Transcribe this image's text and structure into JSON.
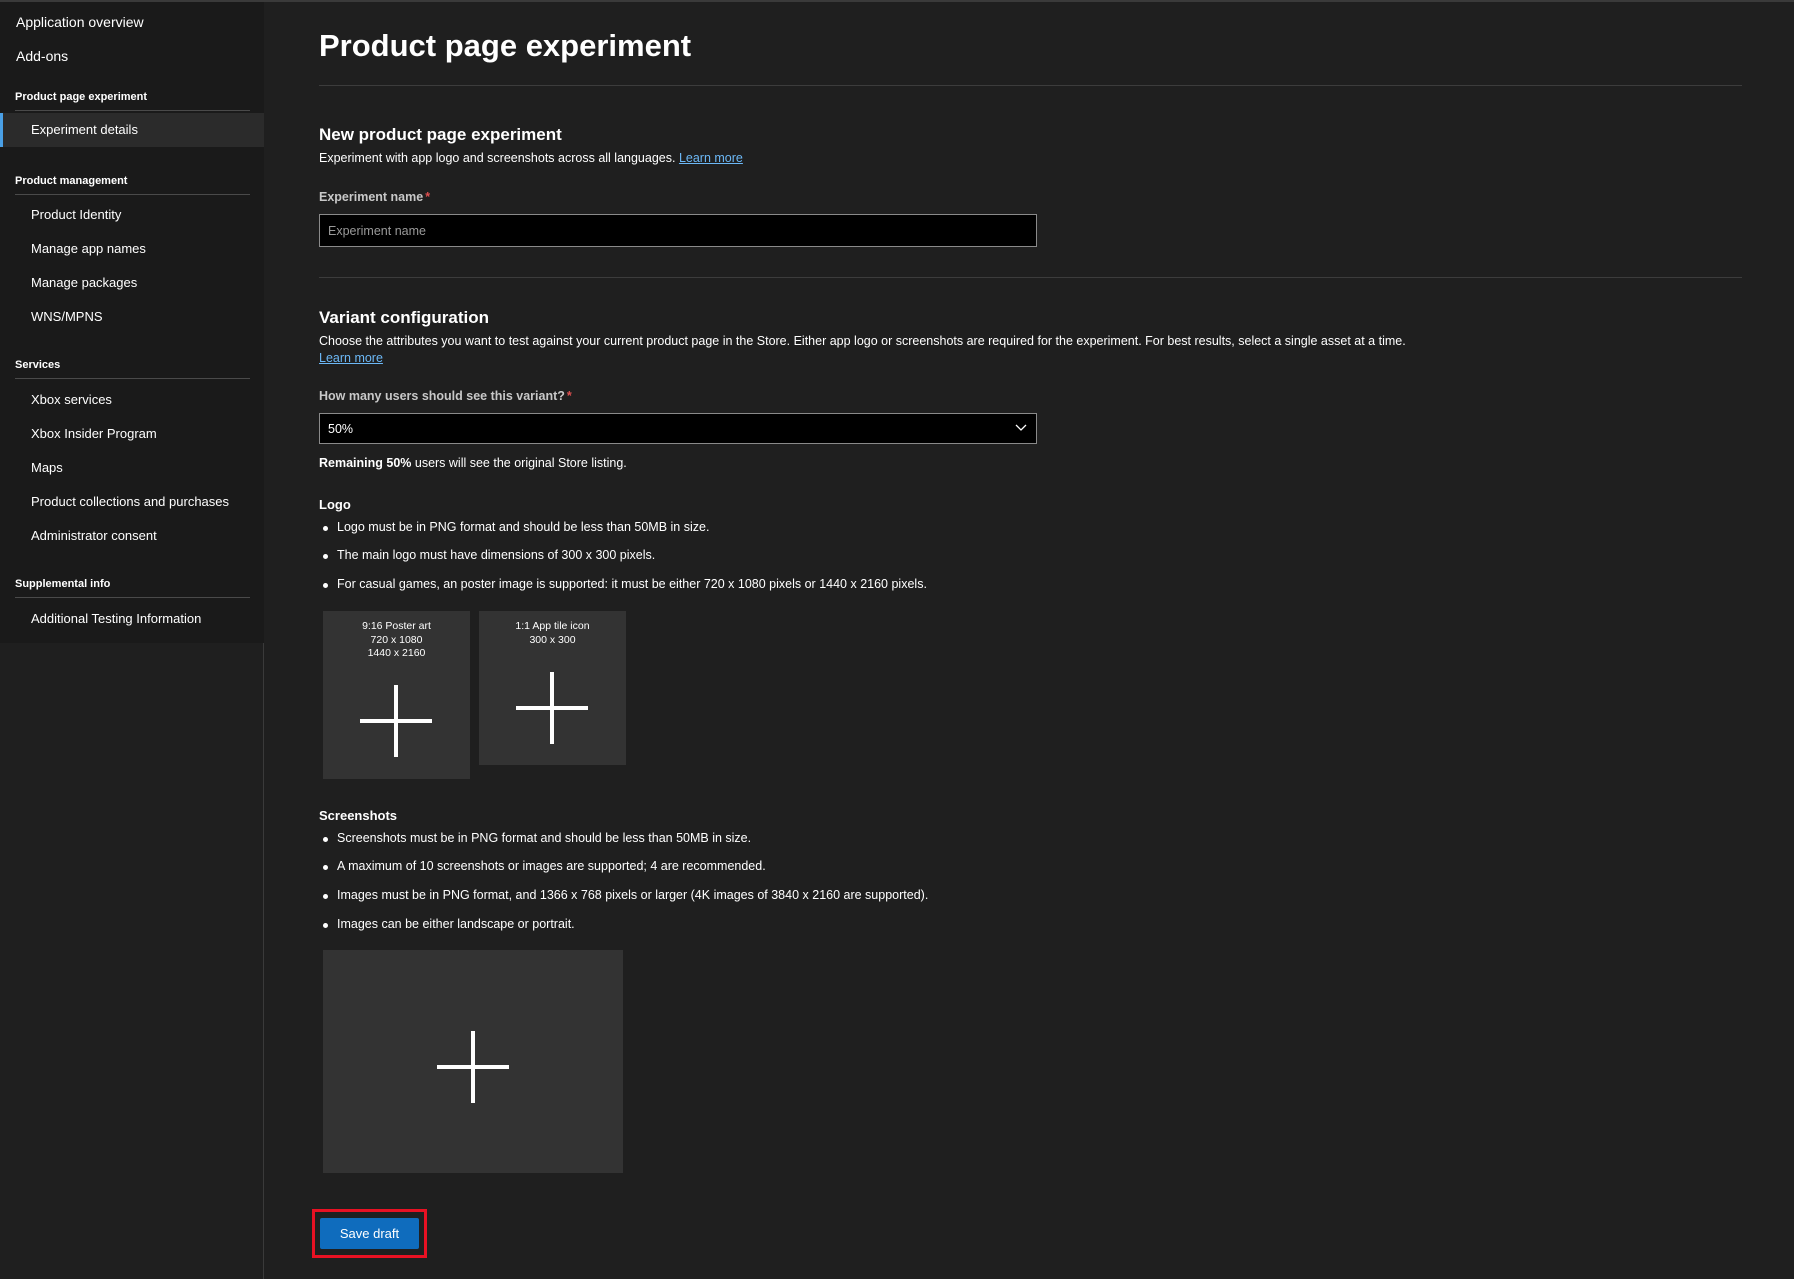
{
  "sidebar": {
    "top_items": [
      "Application overview",
      "Add-ons"
    ],
    "sections": [
      {
        "header": "Product page experiment",
        "items": [
          "Experiment details"
        ]
      },
      {
        "header": "Product management",
        "items": [
          "Product Identity",
          "Manage app names",
          "Manage packages",
          "WNS/MPNS"
        ]
      },
      {
        "header": "Services",
        "items": [
          "Xbox services",
          "Xbox Insider Program",
          "Maps",
          "Product collections and purchases",
          "Administrator consent"
        ]
      },
      {
        "header": "Supplemental info",
        "items": [
          "Additional Testing Information"
        ]
      }
    ],
    "selected_item": "Experiment details"
  },
  "main": {
    "page_title": "Product page experiment",
    "new_experiment": {
      "title": "New product page experiment",
      "description": "Experiment with app logo and screenshots across all languages.",
      "learn_more": "Learn more",
      "name_label": "Experiment name",
      "required_mark": "*",
      "name_placeholder": "Experiment name",
      "name_value": ""
    },
    "variant": {
      "title": "Variant configuration",
      "description": "Choose the attributes you want to test against your current product page in the Store. Either app logo or screenshots are required for the experiment. For best results, select a single asset at a time.",
      "learn_more": "Learn more",
      "users_label": "How many users should see this variant?",
      "required_mark": "*",
      "users_value": "50%",
      "remaining_bold": "Remaining 50%",
      "remaining_rest": " users will see the original Store listing."
    },
    "logo": {
      "heading": "Logo",
      "bullets": [
        "Logo must be in PNG format and should be less than 50MB in size.",
        "The main logo must have dimensions of 300 x 300 pixels.",
        "For casual games, an poster image is supported: it must be either 720 x 1080 pixels or 1440 x 2160 pixels."
      ],
      "tiles": [
        {
          "lines": [
            "9:16 Poster art",
            "720 x 1080",
            "1440 x 2160"
          ]
        },
        {
          "lines": [
            "1:1 App tile icon",
            "300 x 300"
          ]
        }
      ]
    },
    "screenshots": {
      "heading": "Screenshots",
      "bullets": [
        "Screenshots must be in PNG format and should be less than 50MB in size.",
        "A maximum of 10 screenshots or images are supported; 4 are recommended.",
        "Images must be in PNG format, and 1366 x 768 pixels or larger (4K images of 3840 x 2160 are supported).",
        "Images can be either landscape or portrait."
      ]
    },
    "save_label": "Save draft"
  },
  "colors": {
    "background": "#1f1f1f",
    "accent": "#0f6cbd",
    "link": "#6cb8f6",
    "highlight_box": "#e81123",
    "selected_bar": "#4aa0e6"
  }
}
